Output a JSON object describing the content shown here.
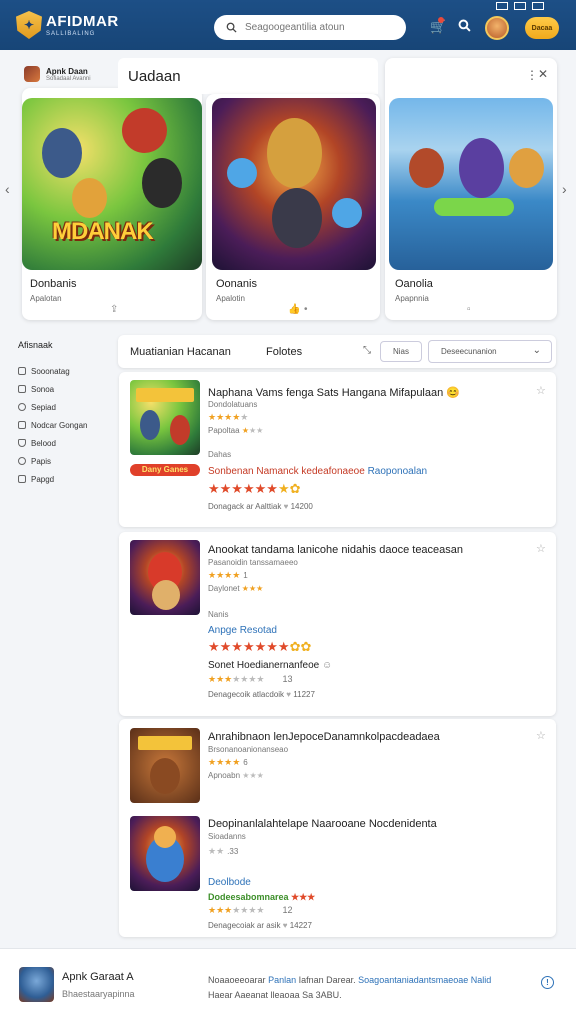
{
  "header": {
    "logo_title": "AFIDMAR",
    "logo_sub": "SALLIBALING",
    "search_placeholder": "Seagoogeantilia atoun",
    "upgrade_label": "Dacaa",
    "icons": [
      "cart-icon",
      "search-icon",
      "avatar"
    ]
  },
  "featured": {
    "user_name": "Apnk Daan",
    "user_sub": "Sofiadaal Avanni",
    "popup_title": "Uadaan",
    "cards": [
      {
        "title": "Donbanis",
        "sub": "Apalotan",
        "art_text": "MDANAK"
      },
      {
        "title": "Oonanis",
        "sub": "Apalotin"
      },
      {
        "title": "Oanolia",
        "sub": "Apapnnia"
      }
    ]
  },
  "sidebar": {
    "title": "Afisnaak",
    "items": [
      {
        "label": "Sooonatag",
        "icon": "square-icon"
      },
      {
        "label": "Sonoa",
        "icon": "square-icon"
      },
      {
        "label": "Sepiad",
        "icon": "circle-icon"
      },
      {
        "label": "Nodcar Gongan",
        "icon": "gift-icon"
      },
      {
        "label": "Belood",
        "icon": "shield-icon"
      },
      {
        "label": "Papis",
        "icon": "circle-icon"
      },
      {
        "label": "Papgd",
        "icon": "square-icon"
      }
    ]
  },
  "tabs": {
    "tab1": "Muatianian Hacanan",
    "tab2": "Folotes",
    "chip": "Nias",
    "select": "Deseecunanion"
  },
  "list": [
    {
      "title": "Naphana Vams fenga Sats Hangana Mifapulaan",
      "sub1": "Dondolatuans",
      "stars1_label": "",
      "sub2": "Papoltaa",
      "sub3": "Dahas",
      "chip": "Dany Ganes",
      "blue": "Sonbenan Namanck kedeafonaeoe",
      "blue2": "Raoponoalan",
      "bottom": "Donagack ar Aalttiak",
      "count": "14200"
    },
    {
      "title": "Anookat tandama lanicohe nidahis daoce teaceasan",
      "sub1": "Pasanoidin tanssamaeeo",
      "sub2": "Nanis",
      "blue": "Anpge Resotad",
      "sub3": "Sonet Hoedianernanfeoe",
      "bottom": "Denagecoik atlacdoik",
      "count": "11227",
      "num": "13"
    },
    {
      "title": "Anrahibnaon lenJepoceDanamnkolpacdeadaea",
      "sub1": "Brsonanoanionanseao",
      "sub2": "Apnoabn",
      "title2": "Deopinanlalahtelape Naarooane Nocdenidenta",
      "sub4": "Sioadanns",
      "blue": "Deolbode",
      "green": "Dodeesabomnarea",
      "bottom": "Denagecoiak ar asik",
      "count": "14227",
      "num": "12"
    }
  ],
  "footer": {
    "title": "Apnk Garaat A",
    "sub": "Bhaestaaryapinna",
    "line1a": "Noaaoeeoarar",
    "line1b": "Panlan",
    "line1c": "Iafnan Darear.",
    "line1d": "Soagoantaniadantsmaeoae Nalid",
    "line2": "Haear Aaeanat lleaoaa Sa 3ABU."
  }
}
